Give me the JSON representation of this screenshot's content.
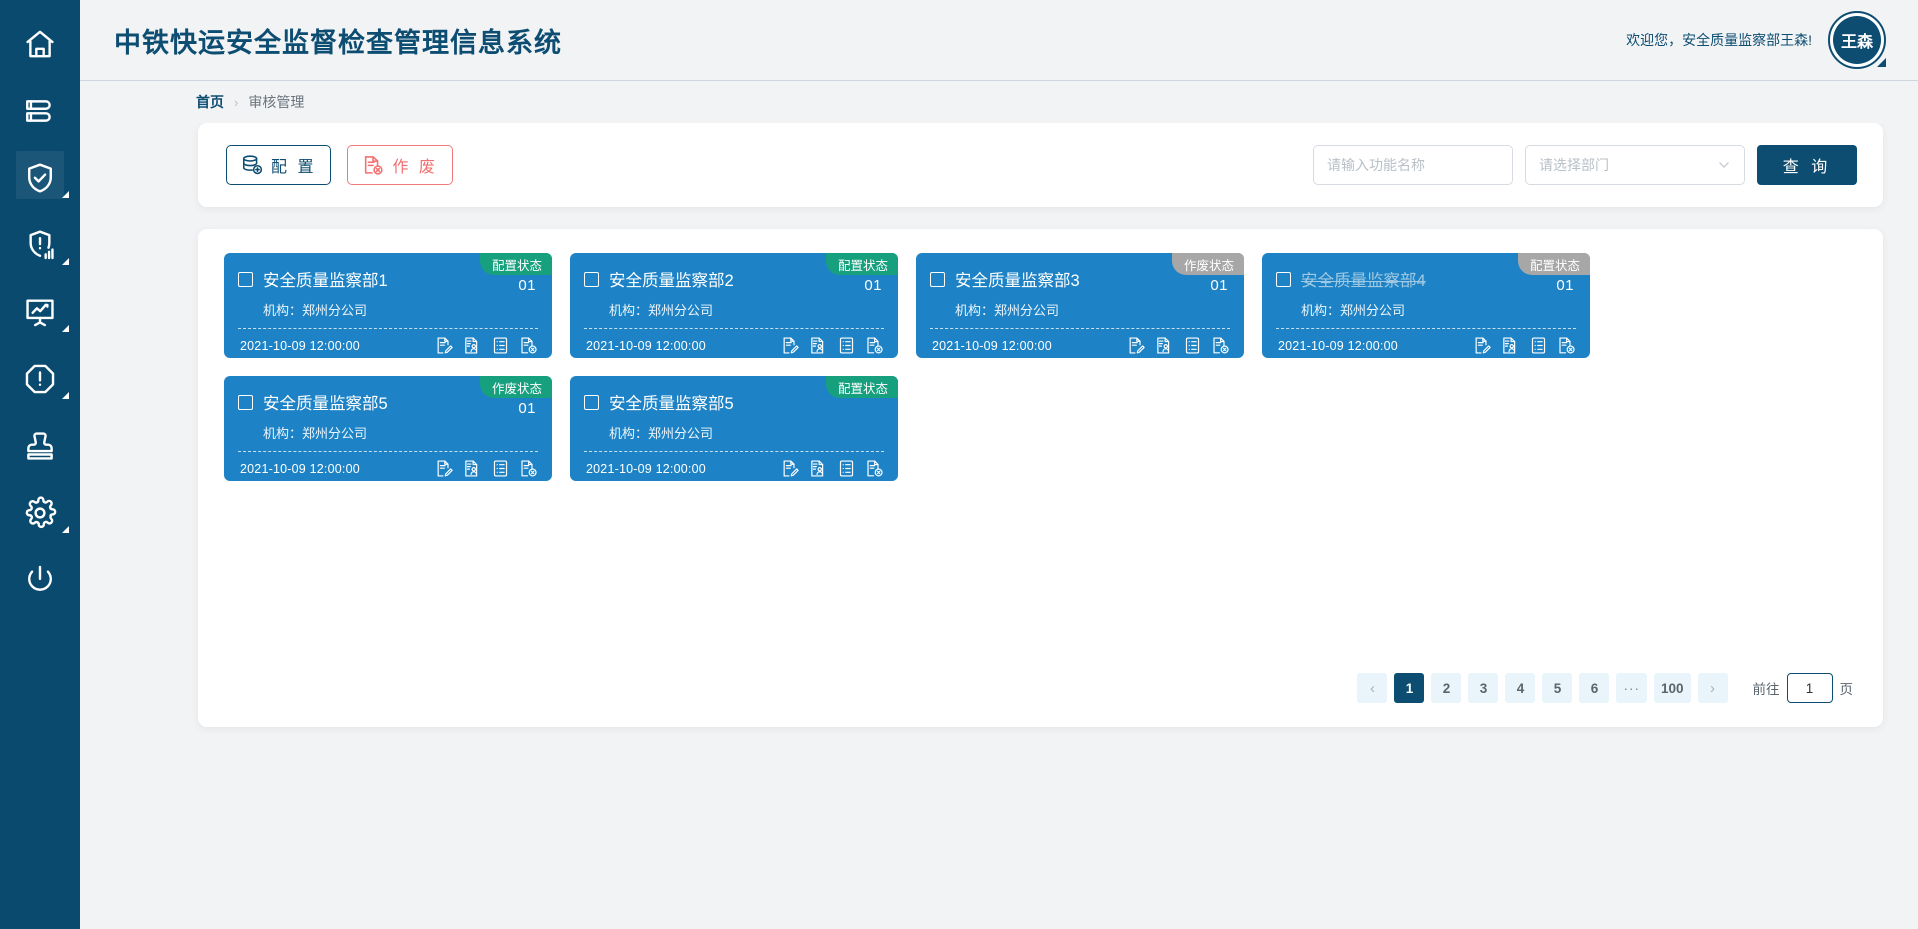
{
  "app": {
    "title": "中铁快运安全监督检查管理信息系统",
    "welcome": "欢迎您，安全质量监察部王森!",
    "avatar_initials": "王森",
    "brand_color": "#0d4d72",
    "card_color": "#1d83c6",
    "badge_green": "#17a07e",
    "badge_gray": "#a7a7a7"
  },
  "sidebar": {
    "items": [
      {
        "icon": "home-icon",
        "has_caret": false,
        "active": false
      },
      {
        "icon": "books-stack-icon",
        "has_caret": false,
        "active": false
      },
      {
        "icon": "shield-check-icon",
        "has_caret": true,
        "active": true
      },
      {
        "icon": "shield-alert-chart-icon",
        "has_caret": true,
        "active": false
      },
      {
        "icon": "presentation-chart-icon",
        "has_caret": true,
        "active": false
      },
      {
        "icon": "octagon-alert-icon",
        "has_caret": true,
        "active": false
      },
      {
        "icon": "stamp-seal-icon",
        "has_caret": false,
        "active": false
      },
      {
        "icon": "gear-icon",
        "has_caret": true,
        "active": false
      },
      {
        "icon": "power-icon",
        "has_caret": false,
        "active": false
      }
    ]
  },
  "breadcrumb": {
    "home": "首页",
    "separator": "›",
    "current": "审核管理"
  },
  "toolbar": {
    "config_label": "配 置",
    "config_icon": "database-add-icon",
    "void_label": "作 废",
    "void_icon": "document-cancel-icon",
    "search_placeholder": "请输入功能名称",
    "search_value": "",
    "dept_placeholder": "请选择部门",
    "dept_value": "",
    "query_label": "查 询"
  },
  "cards": [
    {
      "title": "安全质量监察部1",
      "org": "机构：郑州分公司",
      "date": "2021-10-09 12:00:00",
      "badge": "配置状态",
      "badge_style": "green",
      "number": "01",
      "struck": false,
      "checked": false
    },
    {
      "title": "安全质量监察部2",
      "org": "机构：郑州分公司",
      "date": "2021-10-09 12:00:00",
      "badge": "配置状态",
      "badge_style": "green",
      "number": "01",
      "struck": false,
      "checked": false
    },
    {
      "title": "安全质量监察部3",
      "org": "机构：郑州分公司",
      "date": "2021-10-09 12:00:00",
      "badge": "作废状态",
      "badge_style": "gray",
      "number": "01",
      "struck": false,
      "checked": false
    },
    {
      "title": "安全质量监察部4",
      "org": "机构：郑州分公司",
      "date": "2021-10-09 12:00:00",
      "badge": "配置状态",
      "badge_style": "gray",
      "number": "01",
      "struck": true,
      "checked": false
    },
    {
      "title": "安全质量监察部5",
      "org": "机构：郑州分公司",
      "date": "2021-10-09 12:00:00",
      "badge": "作废状态",
      "badge_style": "green",
      "number": "01",
      "struck": false,
      "checked": false
    },
    {
      "title": "安全质量监察部5",
      "org": "机构：郑州分公司",
      "date": "2021-10-09 12:00:00",
      "badge": "配置状态",
      "badge_style": "green",
      "number": "",
      "struck": false,
      "checked": false
    }
  ],
  "card_actions": [
    "edit-document-icon",
    "document-person-icon",
    "document-list-icon",
    "document-cancel-icon"
  ],
  "pagination": {
    "prev": "‹",
    "next": "›",
    "pages": [
      "1",
      "2",
      "3",
      "4",
      "5",
      "6",
      "···",
      "100"
    ],
    "active": "1",
    "goto_label": "前往",
    "goto_value": "1",
    "page_unit": "页"
  }
}
